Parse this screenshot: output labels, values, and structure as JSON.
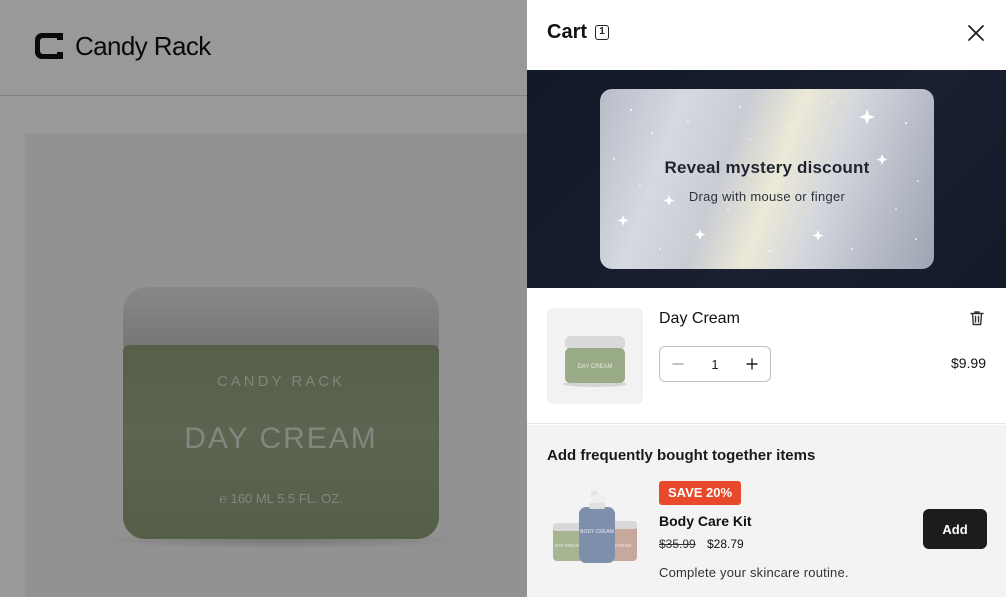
{
  "store": {
    "logo_text": "Candy Rack",
    "product": {
      "jar_brand": "CANDY RACK",
      "jar_title": "DAY CREAM",
      "jar_volume": "℮ 160 ML 5.5 FL. OZ."
    }
  },
  "cart": {
    "title": "Cart",
    "count": "1",
    "icons": {
      "close": "close-icon",
      "count": "count-badge-icon"
    },
    "scratch_card": {
      "title": "Reveal mystery discount",
      "subtitle": "Drag with mouse or finger"
    },
    "items": [
      {
        "name": "Day Cream",
        "quantity": "1",
        "price": "$9.99",
        "thumb_label": "DAY CREAM",
        "icons": {
          "remove": "trash-icon",
          "minus": "minus-icon",
          "plus": "plus-icon"
        }
      }
    ],
    "upsell": {
      "title": "Add frequently bought together items",
      "badge": "SAVE 20%",
      "name": "Body Care Kit",
      "compare_price": "$35.99",
      "price": "$28.79",
      "description": "Complete your skincare routine.",
      "add_label": "Add",
      "image_labels": [
        "BODY CREAM",
        "DAY CREAM",
        "CREAM"
      ]
    }
  },
  "colors": {
    "badge": "#e8492a",
    "add_button": "#1c1c1c",
    "promo_bg": "#111827",
    "jar_green": "#95a582"
  }
}
